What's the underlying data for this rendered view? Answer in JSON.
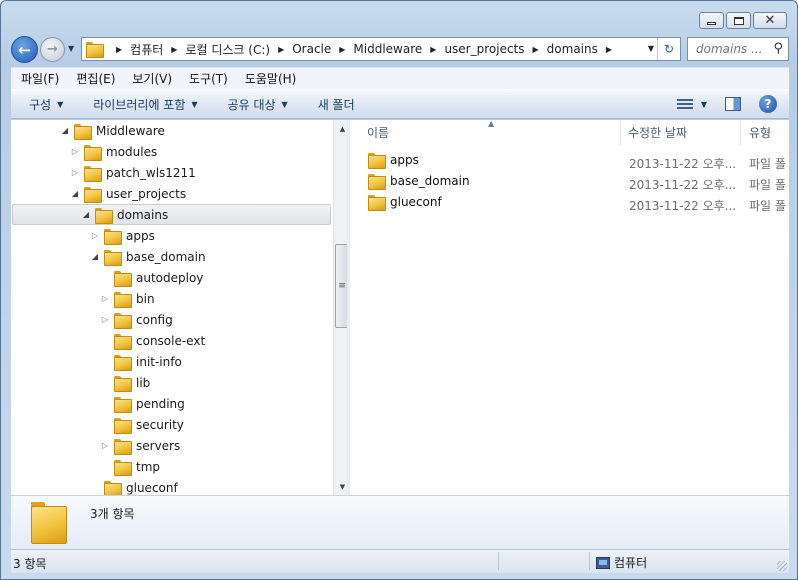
{
  "window": {
    "caption": {
      "minimize": "",
      "maximize": "",
      "close": "✕"
    }
  },
  "navigation": {
    "back_glyph": "←",
    "forward_glyph": "→",
    "history_glyph": "▼",
    "breadcrumbs": [
      "컴퓨터",
      "로컬 디스크 (C:)",
      "Oracle",
      "Middleware",
      "user_projects",
      "domains"
    ],
    "refresh_glyph": "↻",
    "search_placeholder": "domains ..."
  },
  "menu": [
    "파일(F)",
    "편집(E)",
    "보기(V)",
    "도구(T)",
    "도움말(H)"
  ],
  "commands": [
    {
      "label": "구성",
      "dropdown": true
    },
    {
      "label": "라이브러리에 포함",
      "dropdown": true
    },
    {
      "label": "공유 대상",
      "dropdown": true
    },
    {
      "label": "새 폴더",
      "dropdown": false
    }
  ],
  "icons": {
    "views": "views-icon",
    "preview": "preview-pane-icon",
    "help": "help-icon",
    "help_glyph": "?"
  },
  "tree": {
    "items": [
      {
        "label": "Middleware",
        "level": 0,
        "expander": "open"
      },
      {
        "label": "modules",
        "level": 1,
        "expander": "closed"
      },
      {
        "label": "patch_wls1211",
        "level": 1,
        "expander": "closed"
      },
      {
        "label": "user_projects",
        "level": 1,
        "expander": "open"
      },
      {
        "label": "domains",
        "level": 2,
        "expander": "open",
        "selected": true
      },
      {
        "label": "apps",
        "level": 3,
        "expander": "closed"
      },
      {
        "label": "base_domain",
        "level": 3,
        "expander": "open"
      },
      {
        "label": "autodeploy",
        "level": 4,
        "expander": "none"
      },
      {
        "label": "bin",
        "level": 4,
        "expander": "closed"
      },
      {
        "label": "config",
        "level": 4,
        "expander": "closed"
      },
      {
        "label": "console-ext",
        "level": 4,
        "expander": "none"
      },
      {
        "label": "init-info",
        "level": 4,
        "expander": "none"
      },
      {
        "label": "lib",
        "level": 4,
        "expander": "none"
      },
      {
        "label": "pending",
        "level": 4,
        "expander": "none"
      },
      {
        "label": "security",
        "level": 4,
        "expander": "none"
      },
      {
        "label": "servers",
        "level": 4,
        "expander": "closed"
      },
      {
        "label": "tmp",
        "level": 4,
        "expander": "none"
      },
      {
        "label": "glueconf",
        "level": 3,
        "expander": "none"
      }
    ],
    "scroll_thumb_glyph": "≡"
  },
  "columns": {
    "name": "이름",
    "date": "수정한 날짜",
    "type": "유형",
    "sort_glyph": "▲"
  },
  "files": [
    {
      "name": "apps",
      "date": "2013-11-22 오후...",
      "type": "파일 폴"
    },
    {
      "name": "base_domain",
      "date": "2013-11-22 오후...",
      "type": "파일 폴"
    },
    {
      "name": "glueconf",
      "date": "2013-11-22 오후...",
      "type": "파일 폴"
    }
  ],
  "details": {
    "count_text": "3개 항목"
  },
  "status": {
    "left": "3 항목",
    "right": "컴퓨터"
  },
  "colors": {
    "accent": "#1f5cb8",
    "folder": "#f2c23d",
    "selection": "#e1e3e7"
  }
}
